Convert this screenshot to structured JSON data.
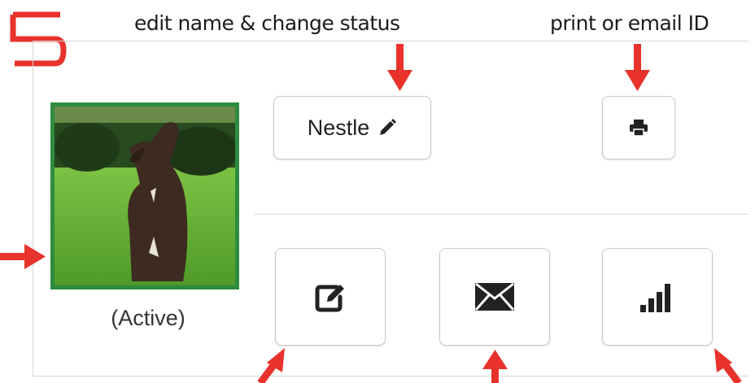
{
  "step": {
    "number": "5"
  },
  "callouts": {
    "edit": "edit name & change status",
    "print": "print or email ID"
  },
  "pet": {
    "name": "Nestle",
    "status": "(Active)",
    "photo_alt": "dog-photo"
  },
  "icons": {
    "name_edit": "pencil-icon",
    "print": "printer-icon",
    "edit": "edit-square-icon",
    "email": "envelope-icon",
    "signal": "signal-bars-icon"
  },
  "colors": {
    "annotation": "#e8322c",
    "photo_border": "#2e8b3f"
  }
}
